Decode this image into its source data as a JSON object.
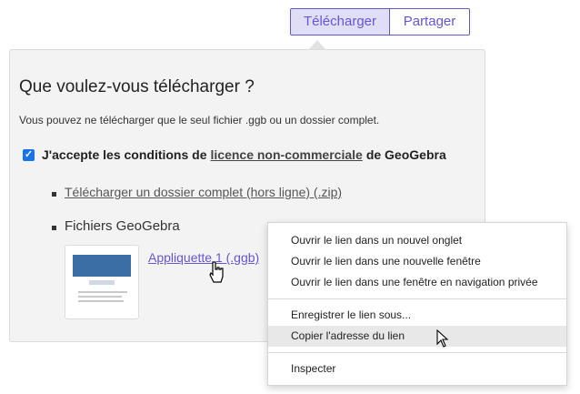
{
  "tabs": {
    "download": "Télécharger",
    "share": "Partager"
  },
  "panel": {
    "title": "Que voulez-vous télécharger ?",
    "description": "Vous pouvez ne télécharger que le seul fichier .ggb ou un dossier complet.",
    "accept_prefix": "J'accepte les conditions de",
    "accept_license": "licence non-commerciale",
    "accept_suffix": "de GeoGebra",
    "checkbox_checked": true,
    "download_folder_link": "Télécharger un dossier complet (hors ligne) (.zip)",
    "files_label": "Fichiers GeoGebra",
    "file_link": "Appliquette 1 (.ggb)"
  },
  "context_menu": {
    "items": [
      "Ouvrir le lien dans un nouvel onglet",
      "Ouvrir le lien dans une nouvelle fenêtre",
      "Ouvrir le lien dans une fenêtre en navigation privée",
      "Enregistrer le lien sous...",
      "Copier l'adresse du lien",
      "Inspecter"
    ],
    "highlighted": "Copier l'adresse du lien"
  },
  "colors": {
    "accent": "#6557d2",
    "checkbox": "#1a73e8",
    "panel_bg": "#f3f3f3"
  }
}
